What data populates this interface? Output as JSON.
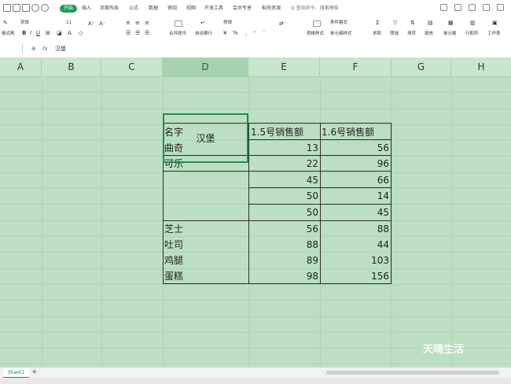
{
  "menu": {
    "tabs": [
      "开始",
      "插入",
      "页面布局",
      "公式",
      "数据",
      "审阅",
      "视图",
      "开发工具",
      "会员专享",
      "稻壳资源"
    ],
    "active_tab": "开始",
    "search_placeholder": "Q 查找命令、搜索模板",
    "accent_color": "#1f9d55"
  },
  "ribbon": {
    "format_painter": "格式刷",
    "font_name": "宋体",
    "font_size": "11",
    "merge_center": "合并居中",
    "auto_wrap": "自动换行",
    "number_format": "常规",
    "cond_format": "条件格式",
    "table_style": "表格样式",
    "cell_style": "单元格样式",
    "sum": "求和",
    "filter": "筛选",
    "sort": "排序",
    "fill": "填充",
    "cells": "单元格",
    "row_col": "行和列",
    "worksheet": "工作表"
  },
  "formula_bar": {
    "fx": "fx",
    "content": "汉堡"
  },
  "columns": [
    "A",
    "B",
    "C",
    "D",
    "E",
    "F",
    "G",
    "H"
  ],
  "selected_column": "D",
  "table": {
    "headers": [
      "名字",
      "1.5号销售额",
      "1.6号销售额"
    ],
    "rows": [
      {
        "name": "曲奇",
        "e": "13",
        "f": "56"
      },
      {
        "name": "可乐",
        "e": "22",
        "f": "96"
      },
      {
        "name": "汉堡",
        "e": "45",
        "f": "66"
      },
      {
        "name": "",
        "e": "50",
        "f": "14"
      },
      {
        "name": "",
        "e": "50",
        "f": "45"
      },
      {
        "name": "芝士",
        "e": "56",
        "f": "88"
      },
      {
        "name": "吐司",
        "e": "88",
        "f": "44"
      },
      {
        "name": "鸡腿",
        "e": "89",
        "f": "103"
      },
      {
        "name": "蛋糕",
        "e": "98",
        "f": "156"
      }
    ]
  },
  "sheet_tab": "Sheet1",
  "watermark": "天晴生活"
}
